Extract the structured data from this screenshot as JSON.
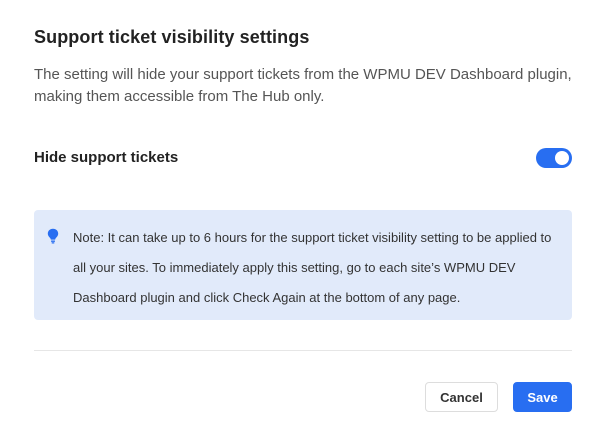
{
  "dialog": {
    "title": "Support ticket visibility settings",
    "description": "The setting will hide your support tickets from the WPMU DEV Dashboard plugin, making them accessible from The Hub only."
  },
  "setting": {
    "label": "Hide support tickets",
    "toggle_state": "on"
  },
  "notice": {
    "icon": "lightbulb-icon",
    "text": "Note: It can take up to 6 hours for the support ticket visibility setting to be applied to all your sites. To immediately apply this setting, go to each site’s WPMU DEV Dashboard plugin and click Check Again at the bottom of any page."
  },
  "actions": {
    "cancel_label": "Cancel",
    "save_label": "Save"
  },
  "colors": {
    "accent": "#286ef1",
    "notice_background": "#e1eafa",
    "divider": "#e6e6e6"
  }
}
